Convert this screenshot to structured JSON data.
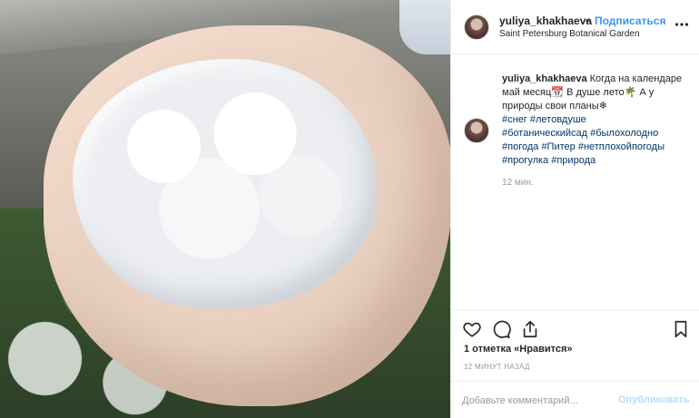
{
  "photo": {
    "alt_subject": "hands-holding-hail"
  },
  "post": {
    "author": {
      "username": "yuliya_khakhaeva",
      "separator": "•",
      "follow_label": "Подписаться",
      "location": "Saint Petersburg Botanical Garden"
    },
    "caption": {
      "username": "yuliya_khakhaeva",
      "line1": "Когда на",
      "line2a": "календаре май месяц",
      "calendar_emoji": "📆",
      "line2b": " В душе",
      "line3a": "лето",
      "palm_emoji": "🌴",
      "line3b": " А у природы свои планы",
      "snow_emoji": "❄",
      "hashtags": [
        "#снег",
        "#летовдуше",
        "#ботаническийсад",
        "#былохолодно",
        "#погода",
        "#Питер",
        "#нетплохойпогоды",
        "#прогулка",
        "#природа"
      ],
      "time": "12 мин."
    },
    "likes_text": "1 отметка «Нравится»",
    "posted_ago": "12 МИНУТ НАЗАД",
    "comment": {
      "placeholder": "Добавьте комментарий...",
      "publish_label": "Опубликовать"
    }
  },
  "icons": [
    "more-icon",
    "heart-icon",
    "comment-icon",
    "share-icon",
    "bookmark-icon"
  ],
  "colors": {
    "link": "#3897f0",
    "hashtag": "#003569",
    "muted": "#999999",
    "publish_disabled": "#b2dffc"
  }
}
